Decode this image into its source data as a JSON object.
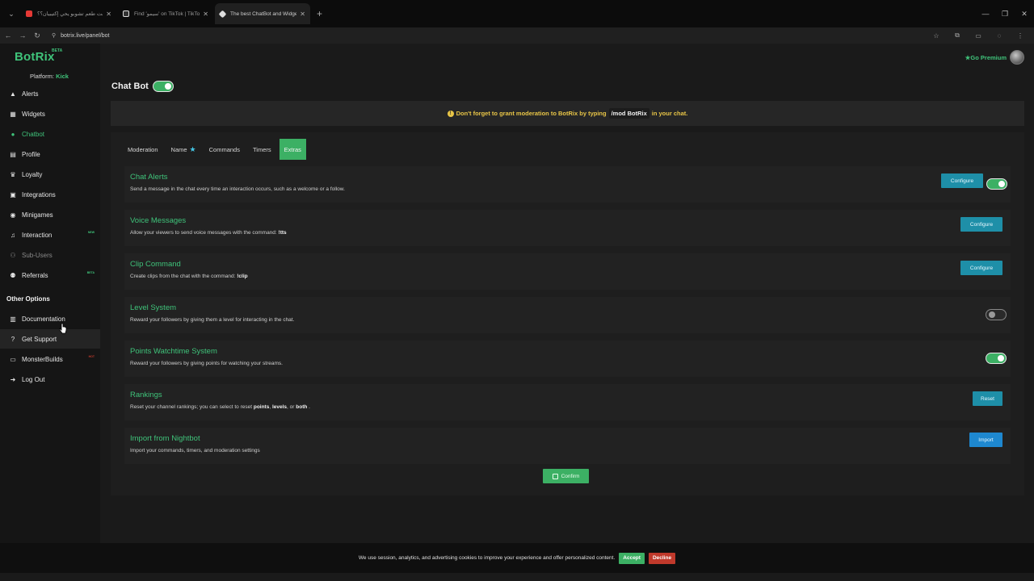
{
  "browser": {
    "tabs": [
      {
        "title": "أنت طعم تشوبو يحي إكتيبيان؟؟ /...",
        "favicon_color": "#e53935",
        "active": false
      },
      {
        "title": "Find 'سيمو' on TikTok | TikTok S...",
        "favicon_color": "#ffffff",
        "active": false
      },
      {
        "title": "The best ChatBot and Widgets f...",
        "favicon_color": "#ffffff",
        "active": true
      }
    ],
    "url": "botrix.live/panel/bot"
  },
  "sidebar": {
    "logo": "BotRix",
    "logo_badge": "BETA",
    "platform_label": "Platform:",
    "platform_value": "Kick",
    "items": [
      {
        "label": "Alerts",
        "icon": "bell-icon"
      },
      {
        "label": "Widgets",
        "icon": "widgets-icon"
      },
      {
        "label": "Chatbot",
        "icon": "chat-icon"
      },
      {
        "label": "Profile",
        "icon": "profile-icon"
      },
      {
        "label": "Loyalty",
        "icon": "trophy-icon"
      },
      {
        "label": "Integrations",
        "icon": "integrations-icon"
      },
      {
        "label": "Minigames",
        "icon": "gamepad-icon"
      },
      {
        "label": "Interaction",
        "icon": "music-icon",
        "badge": "NEW"
      },
      {
        "label": "Sub-Users",
        "icon": "users-icon"
      },
      {
        "label": "Referrals",
        "icon": "referrals-icon",
        "badge": "BETA"
      }
    ],
    "other_title": "Other Options",
    "other_items": [
      {
        "label": "Documentation",
        "icon": "book-icon"
      },
      {
        "label": "Get Support",
        "icon": "help-icon"
      },
      {
        "label": "MonsterBuilds",
        "icon": "laptop-icon",
        "badge": "HOT"
      },
      {
        "label": "Log Out",
        "icon": "logout-icon"
      }
    ]
  },
  "header": {
    "premium": "Go Premium"
  },
  "main": {
    "title": "Chat Bot",
    "bot_enabled": true,
    "notice": {
      "before": "Don't forget to grant moderation to BotRix by typing",
      "code": "/mod BotRix",
      "after": "in your chat."
    },
    "tabs": [
      "Moderation",
      "Name",
      "Commands",
      "Timers",
      "Extras"
    ],
    "active_tab": "Extras",
    "features": [
      {
        "title": "Chat Alerts",
        "desc": "Send a message in the chat every time an interaction occurs, such as a welcome or a follow.",
        "button": "Configure",
        "toggle": true
      },
      {
        "title": "Voice Messages",
        "desc_before": "Allow your viewers to send voice messages with the command:",
        "desc_code": "!tts",
        "button": "Configure"
      },
      {
        "title": "Clip Command",
        "desc_before": "Create clips from the chat with the command:",
        "desc_code": "!clip",
        "button": "Configure"
      },
      {
        "title": "Level System",
        "desc": "Reward your followers by giving them a level for interacting in the chat.",
        "toggle": false
      },
      {
        "title": "Points Watchtime System",
        "desc": "Reward your followers by giving points for watching your streams.",
        "toggle": true
      },
      {
        "title": "Rankings",
        "desc_before": "Reset your channel rankings; you can select to reset",
        "desc_b1": "points",
        "desc_sep1": ",",
        "desc_b2": "levels",
        "desc_sep2": ", or",
        "desc_b3": "both",
        "desc_end": ".",
        "button": "Reset"
      },
      {
        "title": "Import from Nightbot",
        "desc": "Import your commands, timers, and moderation settings",
        "button": "Import"
      }
    ],
    "confirm_label": "Confirm"
  },
  "cookie": {
    "text": "We use session, analytics, and advertising cookies to improve your experience and offer personalized content.",
    "accept": "Accept",
    "decline": "Decline"
  },
  "colors": {
    "accent": "#3cb064",
    "notice": "#e8c547",
    "configure": "#1e8fa8",
    "import": "#1e88d0",
    "decline": "#c0392b"
  }
}
